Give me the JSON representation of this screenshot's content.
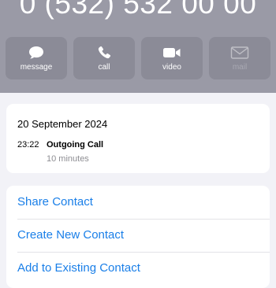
{
  "contact": {
    "phone_number": "0 (532) 532 00 00"
  },
  "actions": [
    {
      "label": "message",
      "icon": "message-bubble-icon"
    },
    {
      "label": "call",
      "icon": "phone-icon"
    },
    {
      "label": "video",
      "icon": "video-camera-icon"
    },
    {
      "label": "mail",
      "icon": "envelope-icon",
      "disabled": true
    }
  ],
  "recents": {
    "date": "20 September 2024",
    "entries": [
      {
        "time": "23:22",
        "type": "Outgoing Call",
        "duration": "10 minutes"
      }
    ]
  },
  "options": [
    {
      "label": "Share Contact"
    },
    {
      "label": "Create New Contact"
    },
    {
      "label": "Add to Existing Contact"
    }
  ],
  "colors": {
    "header_background": "#9a9aa6",
    "action_button_background": "#8b8b97",
    "link_blue": "#1a7fe8",
    "secondary_text": "#8e8e93",
    "page_background": "#f2f2f7"
  }
}
